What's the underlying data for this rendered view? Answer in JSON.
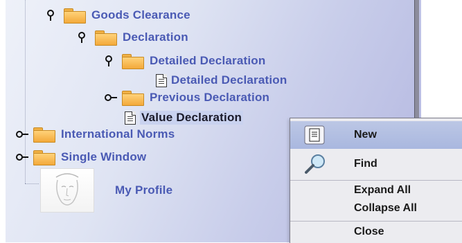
{
  "tree": {
    "goods_clearance": "Goods Clearance",
    "declaration": "Declaration",
    "detailed_declaration_folder": "Detailed Declaration",
    "detailed_declaration_doc": "Detailed Declaration",
    "previous_declaration": "Previous Declaration",
    "value_declaration": "Value Declaration",
    "international_norms": "International Norms",
    "single_window": "Single Window",
    "my_profile": "My Profile"
  },
  "context_menu": {
    "new": "New",
    "find": "Find",
    "expand_all": "Expand All",
    "collapse_all": "Collapse All",
    "close": "Close"
  },
  "colors": {
    "label": "#4a5ab4",
    "menu_highlight": "#b2bfe2",
    "folder": "#f3a93a"
  },
  "icons": {
    "expanded_toggle": "key-expanded-icon",
    "collapsed_toggle": "key-collapsed-icon",
    "folder": "folder-icon",
    "document": "document-icon",
    "find": "magnifier-icon"
  }
}
